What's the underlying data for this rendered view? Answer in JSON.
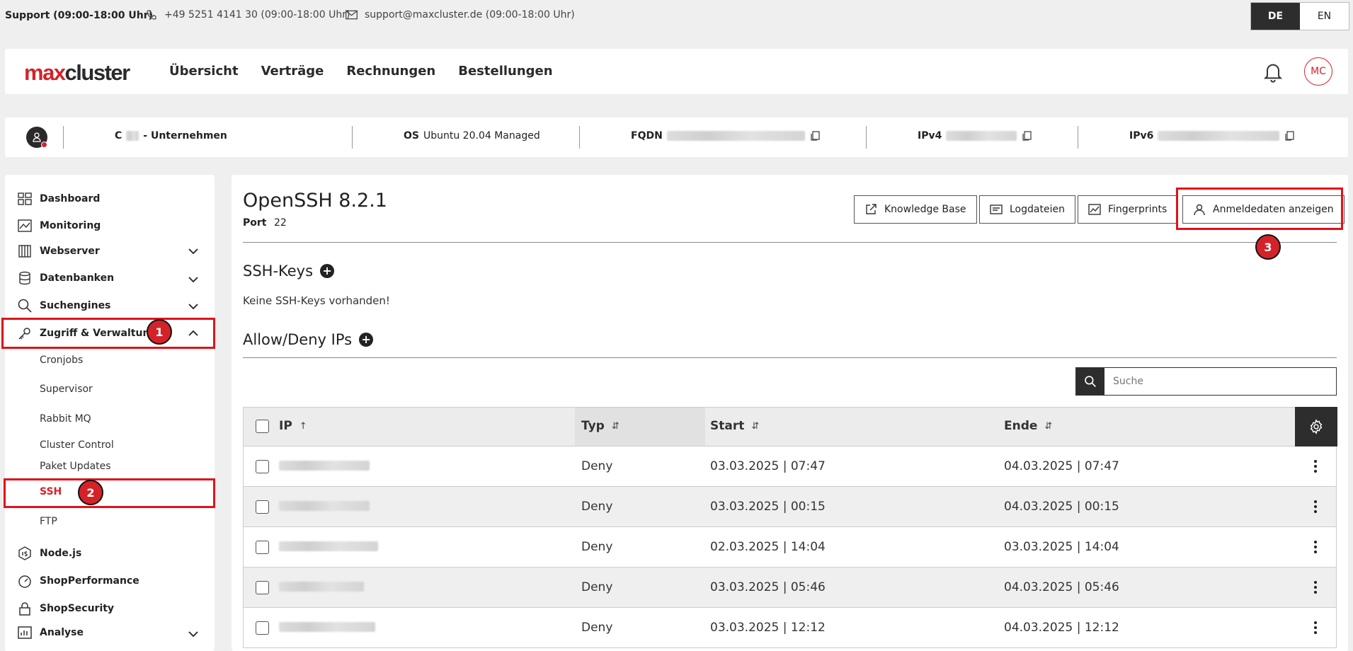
{
  "topbar": {
    "support": "Support (09:00-18:00 Uhr)",
    "phone": "+49 5251 4141 30 (09:00-18:00 Uhr)",
    "email": "support@maxcluster.de (09:00-18:00 Uhr)",
    "lang_de": "DE",
    "lang_en": "EN"
  },
  "nav": {
    "logo_max": "max",
    "logo_cluster": "cluster",
    "links": [
      "Übersicht",
      "Verträge",
      "Rechnungen",
      "Bestellungen"
    ],
    "avatar": "MC"
  },
  "infobar": {
    "company_prefix": "C",
    "company": "-  Unternehmen",
    "os_label": "OS",
    "os_value": "Ubuntu 20.04 Managed",
    "fqdn_label": "FQDN",
    "ipv4_label": "IPv4",
    "ipv6_label": "IPv6"
  },
  "sidebar": {
    "items": {
      "dashboard": "Dashboard",
      "monitoring": "Monitoring",
      "webserver": "Webserver",
      "datenbanken": "Datenbanken",
      "suchengines": "Suchengines",
      "zugriff": "Zugriff & Verwaltung",
      "nodejs": "Node.js",
      "shopperformance": "ShopPerformance",
      "shopsecurity": "ShopSecurity",
      "analyse": "Analyse"
    },
    "sub": [
      "Cronjobs",
      "Supervisor",
      "Rabbit MQ",
      "Cluster Control",
      "Paket Updates",
      "SSH",
      "FTP"
    ]
  },
  "annotations": [
    "1",
    "2",
    "3"
  ],
  "content": {
    "title": "OpenSSH 8.2.1",
    "port_label": "Port",
    "port_value": "22",
    "buttons": {
      "kb": "Knowledge Base",
      "logs": "Logdateien",
      "fingerprints": "Fingerprints",
      "credentials": "Anmeldedaten anzeigen"
    },
    "ssh_keys_title": "SSH-Keys",
    "ssh_keys_empty": "Keine SSH-Keys vorhanden!",
    "allow_deny_title": "Allow/Deny IPs",
    "search_placeholder": "Suche"
  },
  "table": {
    "headers": {
      "ip": "IP",
      "typ": "Typ",
      "start": "Start",
      "ende": "Ende"
    },
    "sort_icons": {
      "ip": "↑",
      "typ": "⇵",
      "start": "⇵",
      "ende": "⇵"
    },
    "rows": [
      {
        "typ": "Deny",
        "start": "03.03.2025 | 07:47",
        "ende": "04.03.2025 | 07:47"
      },
      {
        "typ": "Deny",
        "start": "03.03.2025 | 00:15",
        "ende": "04.03.2025 | 00:15"
      },
      {
        "typ": "Deny",
        "start": "02.03.2025 | 14:04",
        "ende": "03.03.2025 | 14:04"
      },
      {
        "typ": "Deny",
        "start": "03.03.2025 | 05:46",
        "ende": "04.03.2025 | 05:46"
      },
      {
        "typ": "Deny",
        "start": "03.03.2025 | 12:12",
        "ende": "04.03.2025 | 12:12"
      }
    ]
  }
}
